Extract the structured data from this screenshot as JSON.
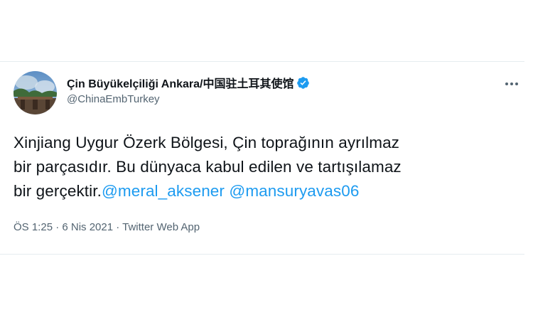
{
  "tweet": {
    "display_name": "Çin Büyükelçiliği Ankara/中国驻土耳其使馆",
    "handle": "@ChinaEmbTurkey",
    "verified": true,
    "icons": {
      "verified": "verified-badge-icon",
      "more": "more-options-icon",
      "avatar": "avatar-photo"
    },
    "body": {
      "line1": "Xinjiang Uygur Özerk Bölgesi, Çin toprağının ayrılmaz",
      "line2": "bir parçasıdır. Bu dünyaca kabul edilen ve tartışılamaz",
      "line3": "bir gerçektir.",
      "mentions": [
        "@meral_aksener",
        "@mansuryavas06"
      ]
    },
    "meta": "ÖS 1:25 · 6 Nis 2021 · Twitter Web App"
  },
  "colors": {
    "text": "#0f1419",
    "secondary": "#536471",
    "link": "#1d9bf0",
    "border": "#e6ecf0"
  }
}
